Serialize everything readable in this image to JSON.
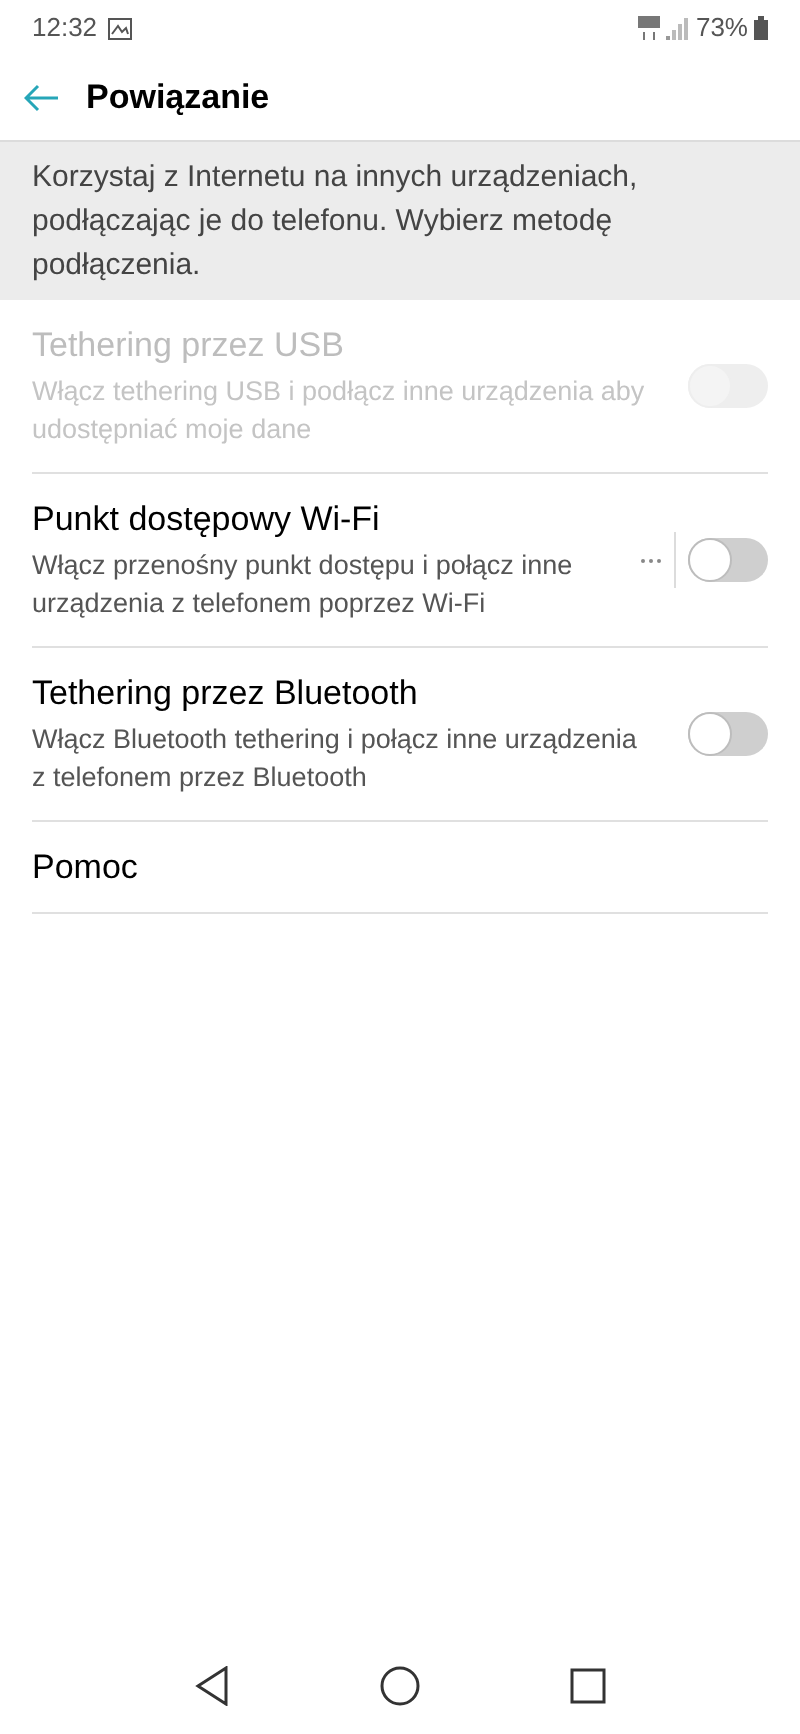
{
  "status_bar": {
    "time": "12:32",
    "battery": "73%"
  },
  "header": {
    "title": "Powiązanie"
  },
  "description": "Korzystaj z Internetu na innych urządzeniach, podłączając je do telefonu. Wybierz metodę podłączenia.",
  "items": [
    {
      "kind": "toggle",
      "title": "Tethering przez USB",
      "subtitle": "Włącz tethering USB i podłącz inne urządzenia aby udostępniać moje dane",
      "disabled": true,
      "on": false,
      "more": false
    },
    {
      "kind": "toggle",
      "title": "Punkt dostępowy Wi-Fi",
      "subtitle": "Włącz przenośny punkt dostępu i połącz inne urządzenia z telefonem poprzez Wi-Fi",
      "disabled": false,
      "on": false,
      "more": true
    },
    {
      "kind": "toggle",
      "title": "Tethering przez Bluetooth",
      "subtitle": "Włącz Bluetooth tethering i połącz inne urządzenia z telefonem przez Bluetooth",
      "disabled": false,
      "on": false,
      "more": false
    },
    {
      "kind": "link",
      "title": "Pomoc"
    }
  ]
}
